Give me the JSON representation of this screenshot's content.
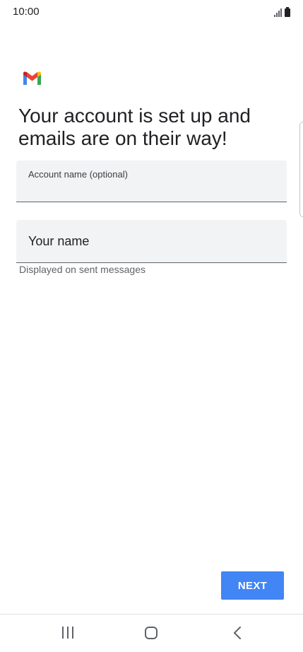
{
  "status_bar": {
    "time": "10:00",
    "icons": [
      "signal-icon",
      "battery-icon"
    ]
  },
  "logo": {
    "icon": "gmail-logo-icon"
  },
  "title": "Your account is set up and emails are on their way!",
  "account_name_field": {
    "label": "Account name (optional)",
    "value": ""
  },
  "your_name_field": {
    "placeholder": "Your name",
    "value": "",
    "helper": "Displayed on sent messages"
  },
  "next_button": {
    "label": "NEXT"
  },
  "colors": {
    "primary": "#4285f4",
    "field_bg": "#f1f3f4",
    "text": "#202124",
    "secondary_text": "#5f6368"
  },
  "nav_bar": {
    "icons": [
      "recent-apps-icon",
      "home-icon",
      "back-icon"
    ]
  }
}
